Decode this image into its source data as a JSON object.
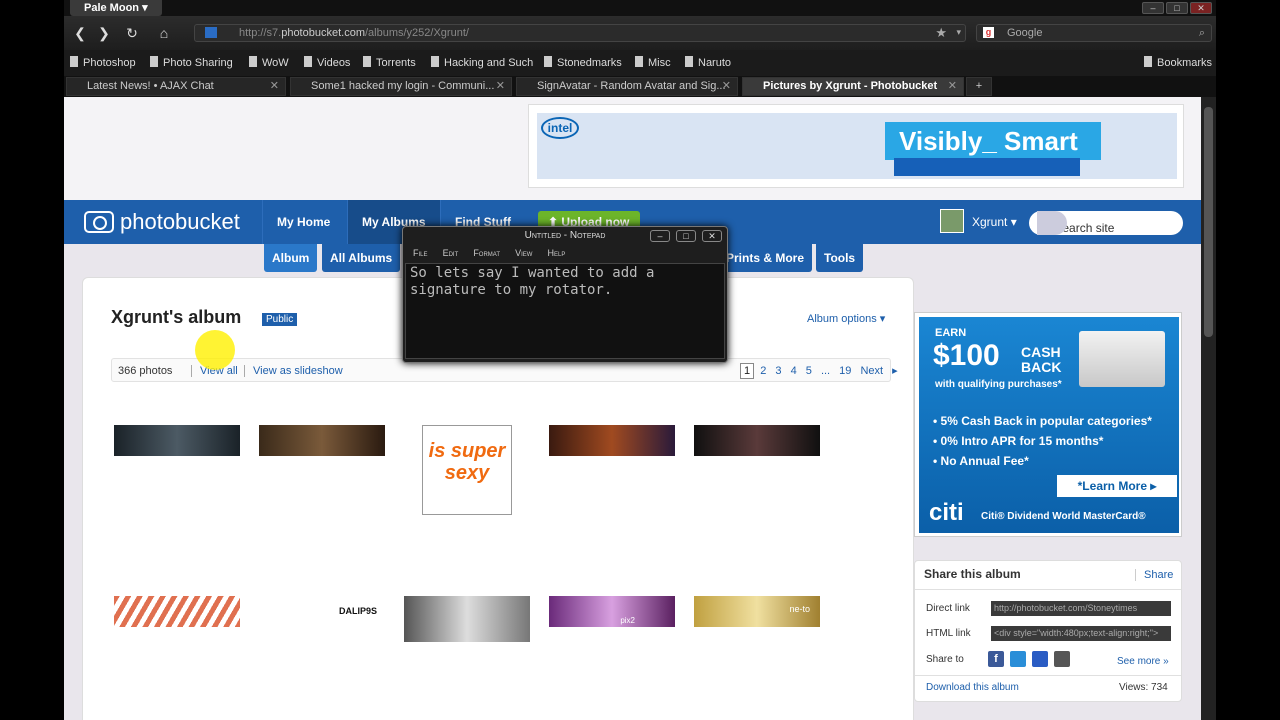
{
  "browser": {
    "app_name": "Pale Moon",
    "url_prefix": "http://s7.",
    "url_domain": "photobucket.com",
    "url_path": "/albums/y252/Xgrunt/",
    "search_engine": "Google",
    "window_buttons": [
      "–",
      "□",
      "✕"
    ]
  },
  "bookmarks": [
    "Photoshop",
    "Photo Sharing",
    "WoW",
    "Videos",
    "Torrents",
    "Hacking and Such",
    "Stonedmarks",
    "Misc",
    "Naruto"
  ],
  "bookmarks_menu": "Bookmarks",
  "tabs": [
    {
      "label": "Latest News! • AJAX Chat"
    },
    {
      "label": "Some1 hacked my login - Communi..."
    },
    {
      "label": "SignAvatar - Random Avatar and Sig..."
    },
    {
      "label": "Pictures by Xgrunt - Photobucket"
    }
  ],
  "intel_ad": {
    "logo": "intel",
    "slogan": "Visibly_ Smart"
  },
  "photobucket": {
    "logo": "photobucket",
    "nav": [
      "My Home",
      "My Albums",
      "Find Stuff"
    ],
    "upload": "Upload now",
    "user": "Xgrunt ▾",
    "search_placeholder": "▾ Search site",
    "subnav": [
      "Album",
      "All Albums",
      "Prints & More",
      "Tools"
    ]
  },
  "album": {
    "title": "Xgrunt's album",
    "badge": "Public",
    "options": "Album options ▾",
    "count": "366 photos",
    "view_all": "View all",
    "slideshow": "View as slideshow",
    "pages": [
      "1",
      "2",
      "3",
      "4",
      "5",
      "...",
      "19"
    ],
    "next": "Next"
  },
  "citi_ad": {
    "earn": "EARN",
    "amount": "$100",
    "cashback": "CASH BACK",
    "qualifying": "with qualifying purchases*",
    "bullets": [
      "5% Cash Back in popular categories*",
      "0% Intro APR for 15 months*",
      "No Annual Fee*"
    ],
    "learn_more": "*Learn More ▸",
    "brand": "citi",
    "card_name": "Citi® Dividend World MasterCard®"
  },
  "share": {
    "title": "Share this album",
    "share_link": "Share",
    "direct_label": "Direct link",
    "direct_value": "http://photobucket.com/Stoneytimes",
    "html_label": "HTML link",
    "html_value": "<div style=\"width:480px;text-align:right;\">",
    "share_to": "Share to",
    "see_more": "See more »",
    "download": "Download this album",
    "views": "Views: 734"
  },
  "notepad": {
    "title": "Untitled - Notepad",
    "menu": [
      "File",
      "Edit",
      "Format",
      "View",
      "Help"
    ],
    "text": "So lets say I wanted to add a\nsignature to my rotator."
  },
  "thumb_texts": {
    "sexy": "is super sexy",
    "dali": "DALIP9S",
    "pix": "pix2",
    "neto": "ne-to"
  },
  "colors": {
    "pb_blue": "#1e5fab",
    "pb_green": "#6cb52a",
    "citi_blue": "#0b5fa8"
  }
}
